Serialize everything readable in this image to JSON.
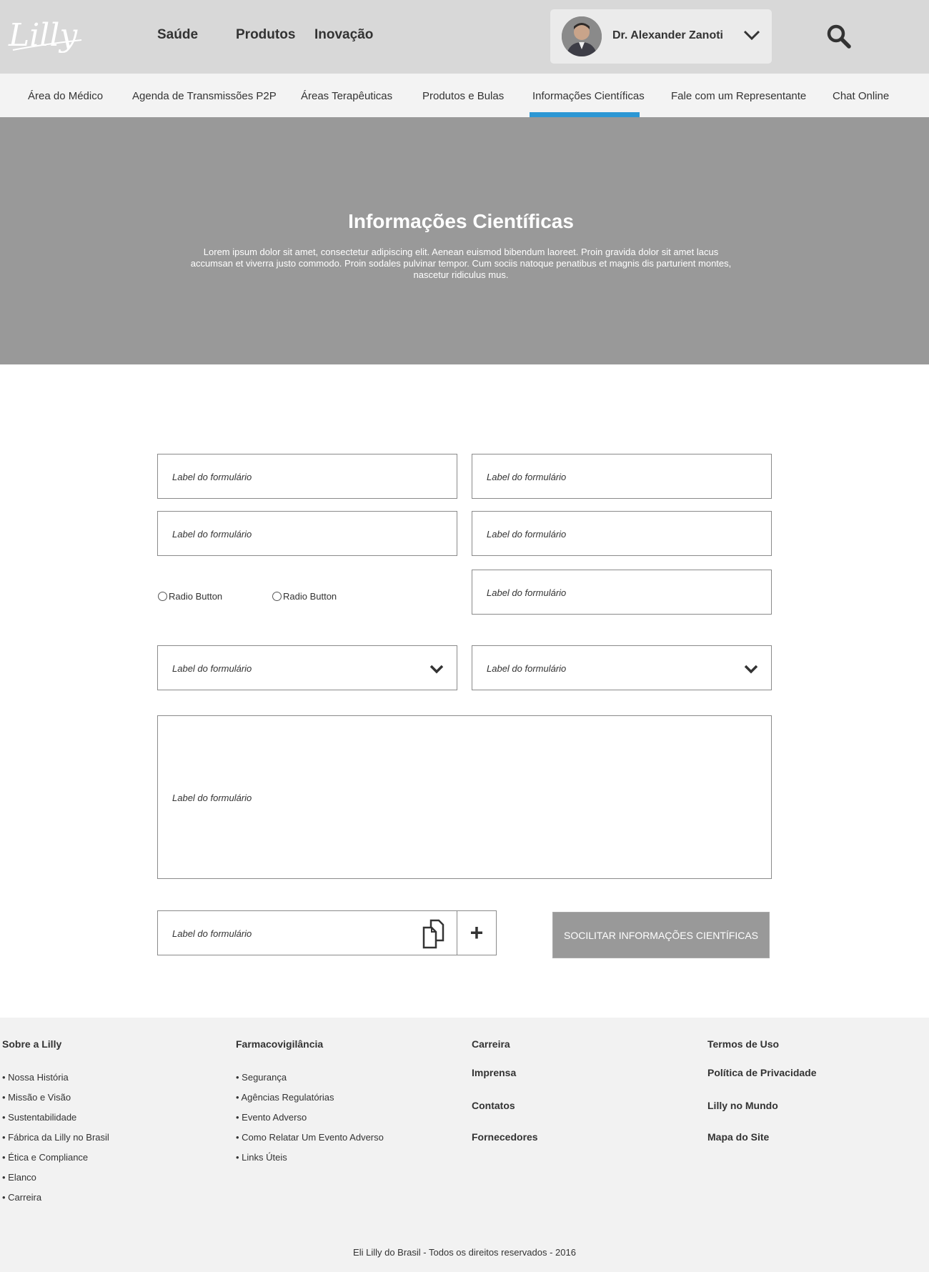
{
  "header": {
    "logo_text": "Lilly",
    "nav": [
      "Saúde",
      "Produtos",
      "Inovação"
    ],
    "user_name": "Dr. Alexander Zanoti"
  },
  "subnav": {
    "items": [
      "Área do Médico",
      "Agenda de Transmissões P2P",
      "Áreas Terapêuticas",
      "Produtos e Bulas",
      "Informações Científicas",
      "Fale com um Representante",
      "Chat Online"
    ],
    "active_index": 4
  },
  "hero": {
    "title": "Informações Científicas",
    "text": "Lorem ipsum dolor sit amet, consectetur adipiscing elit. Aenean euismod bibendum laoreet. Proin gravida dolor sit amet lacus accumsan et viverra justo commodo. Proin sodales pulvinar tempor. Cum sociis natoque penatibus et magnis dis parturient montes, nascetur ridiculus mus."
  },
  "form": {
    "field_label": "Label do formulário",
    "radio_label": "Radio Button",
    "submit_label": "SOCILITAR INFORMAÇÕES CIENTÍFICAS",
    "plus_label": "+"
  },
  "footer": {
    "col1": {
      "heading": "Sobre a Lilly",
      "items": [
        "• Nossa História",
        "• Missão e Visão",
        "• Sustentabilidade",
        "• Fábrica da Lilly no Brasil",
        "• Ética e Compliance",
        "• Elanco",
        "• Carreira"
      ]
    },
    "col2": {
      "heading": "Farmacovigilância",
      "items": [
        "• Segurança",
        "• Agências Regulatórias",
        "• Evento Adverso",
        "• Como Relatar Um Evento Adverso",
        "• Links Úteis"
      ]
    },
    "col3": [
      "Carreira",
      "Imprensa",
      "Contatos",
      "Fornecedores"
    ],
    "col4": [
      "Termos de Uso",
      "Política de Privacidade",
      "Lilly no Mundo",
      "Mapa do Site"
    ],
    "copyright": "Eli Lilly do Brasil - Todos os direitos reservados - 2016"
  },
  "colors": {
    "header_bg": "#d8d8d8",
    "hero_bg": "#999999",
    "accent": "#2c97d4",
    "footer_bg": "#f2f2f2"
  }
}
